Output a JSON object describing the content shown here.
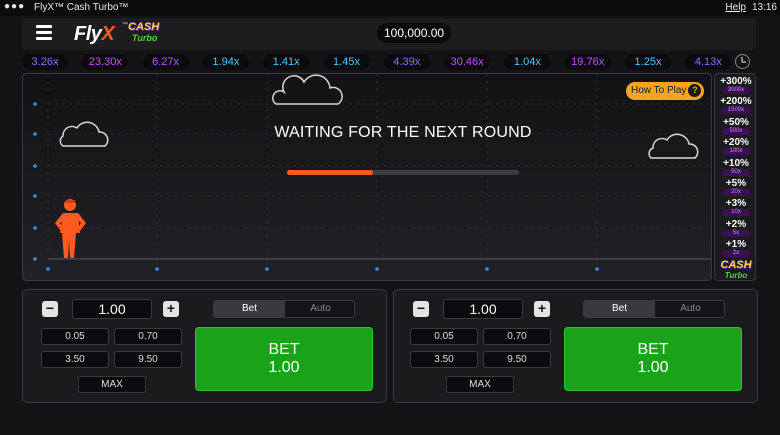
{
  "os_bar": {
    "window_title": "FlyX™ Cash Turbo™",
    "help": "Help",
    "time": "13:16"
  },
  "header": {
    "logo_text": "FlyX",
    "logo_tm": "™",
    "logo_cash": "CASH",
    "logo_turbo": "Turbo",
    "balance": "100,000.00"
  },
  "history": [
    {
      "value": "3.26x",
      "color": "#8a6dff"
    },
    {
      "value": "23.30x",
      "color": "#c050ff"
    },
    {
      "value": "6.27x",
      "color": "#c050ff"
    },
    {
      "value": "1.94x",
      "color": "#4fc3ff"
    },
    {
      "value": "1.41x",
      "color": "#4fc3ff"
    },
    {
      "value": "1.45x",
      "color": "#4fc3ff"
    },
    {
      "value": "4.39x",
      "color": "#8a6dff"
    },
    {
      "value": "30.46x",
      "color": "#c050ff"
    },
    {
      "value": "1.04x",
      "color": "#4fc3ff"
    },
    {
      "value": "19.76x",
      "color": "#c050ff"
    },
    {
      "value": "1.25x",
      "color": "#4fc3ff"
    },
    {
      "value": "4.13x",
      "color": "#8a6dff"
    }
  ],
  "game": {
    "status_text": "WAITING FOR THE NEXT ROUND",
    "progress": 0.37,
    "how_to_play": "How To Play",
    "help_glyph": "?",
    "accent": "#ff5a1f"
  },
  "ladder": [
    {
      "pct": "+300%",
      "mult": "3000x"
    },
    {
      "pct": "+200%",
      "mult": "1500x"
    },
    {
      "pct": "+50%",
      "mult": "500x"
    },
    {
      "pct": "+20%",
      "mult": "100x"
    },
    {
      "pct": "+10%",
      "mult": "50x"
    },
    {
      "pct": "+5%",
      "mult": "20x"
    },
    {
      "pct": "+3%",
      "mult": "10x"
    },
    {
      "pct": "+2%",
      "mult": "5x"
    },
    {
      "pct": "+1%",
      "mult": "2x"
    }
  ],
  "ladder_logo": {
    "cash": "CASH",
    "turbo": "Turbo"
  },
  "panels": [
    {
      "minus": "−",
      "plus": "+",
      "amount": "1.00",
      "tab_bet": "Bet",
      "tab_auto": "Auto",
      "chips": [
        "0.05",
        "0.70",
        "3.50",
        "9.50"
      ],
      "max": "MAX",
      "bet_label": "BET",
      "bet_amount": "1.00"
    },
    {
      "minus": "−",
      "plus": "+",
      "amount": "1.00",
      "tab_bet": "Bet",
      "tab_auto": "Auto",
      "chips": [
        "0.05",
        "0.70",
        "3.50",
        "9.50"
      ],
      "max": "MAX",
      "bet_label": "BET",
      "bet_amount": "1.00"
    }
  ]
}
